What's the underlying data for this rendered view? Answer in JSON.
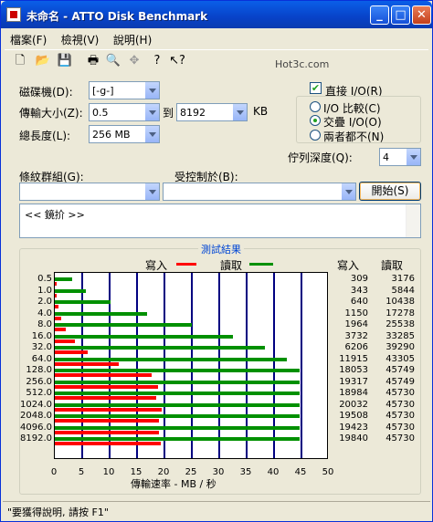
{
  "window": {
    "title": "未命名 - ATTO Disk Benchmark",
    "min": "_",
    "max": "□",
    "close": "✕"
  },
  "menu": [
    "檔案(F)",
    "檢視(V)",
    "說明(H)"
  ],
  "watermark": "Hot3c.com",
  "form": {
    "drive_label": "磁碟機(D):",
    "drive_value": "[-g-]",
    "transfer_label": "傳輸大小(Z):",
    "transfer_from": "0.5",
    "to_label": "到",
    "transfer_to": "8192",
    "kb_label": "KB",
    "total_label": "總長度(L):",
    "total_value": "256 MB",
    "direct_io_label": "直接 I/O(R)",
    "direct_io_checked": true,
    "io_compare": "I/O 比較(C)",
    "overlap_io": "交疊 I/O(O)",
    "neither": "兩者都不(N)",
    "queue_label": "佇列深度(Q):",
    "queue_value": "4",
    "test_group_label": "條紋群組(G):",
    "controlled_by_label": "受控制於(B):",
    "start_button": "開始(S)",
    "description": "<< 鏡扴 >>"
  },
  "results": {
    "title": "測試結果",
    "write_label": "寫入",
    "read_label": "讀取",
    "col_write": "寫入",
    "col_read": "讀取",
    "xaxis_title": "傳輸速率 - MB / 秒"
  },
  "chart_data": {
    "type": "bar",
    "categories": [
      "0.5",
      "1.0",
      "2.0",
      "4.0",
      "8.0",
      "16.0",
      "32.0",
      "64.0",
      "128.0",
      "256.0",
      "512.0",
      "1024.0",
      "2048.0",
      "4096.0",
      "8192.0"
    ],
    "series": [
      {
        "name": "寫入",
        "color": "#ff0000",
        "values_kb": [
          309,
          343,
          640,
          1150,
          1964,
          3732,
          6206,
          11915,
          18053,
          19317,
          18984,
          20032,
          19508,
          19423,
          19840
        ]
      },
      {
        "name": "讀取",
        "color": "#009000",
        "values_kb": [
          3176,
          5844,
          10438,
          17278,
          25538,
          33285,
          39290,
          43305,
          45749,
          45749,
          45730,
          45730,
          45730,
          45730,
          45730
        ]
      }
    ],
    "xlim": [
      0,
      50
    ],
    "xticks": [
      "0",
      "5",
      "10",
      "15",
      "20",
      "25",
      "30",
      "35",
      "40",
      "45",
      "50"
    ]
  },
  "status": "\"要獲得說明, 請按 F1\""
}
